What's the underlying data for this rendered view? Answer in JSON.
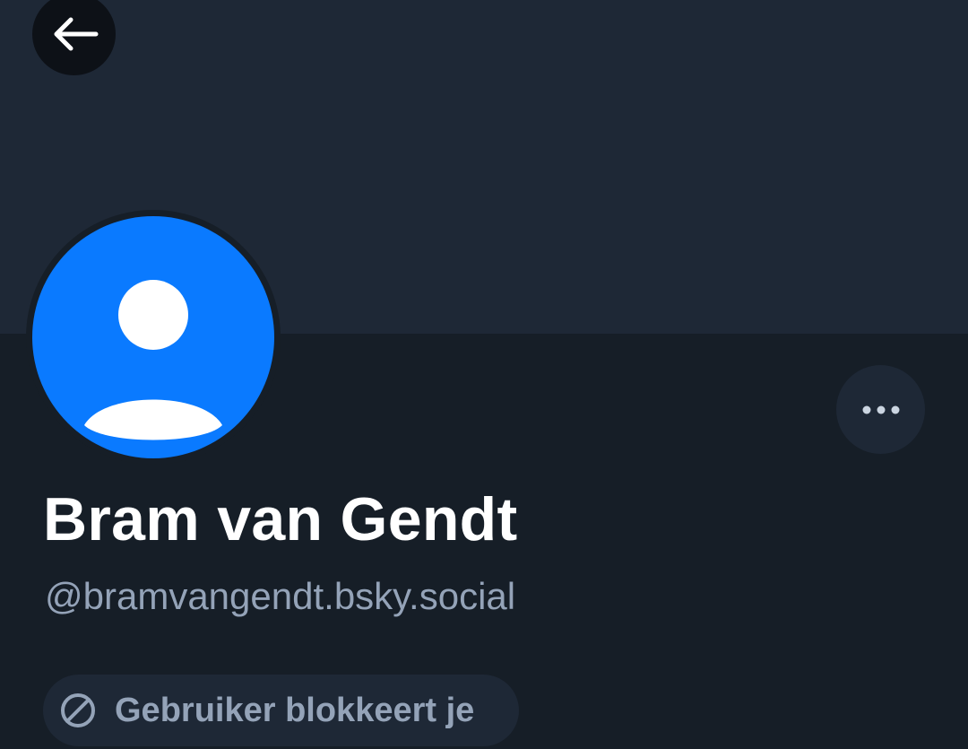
{
  "profile": {
    "display_name": "Bram van Gendt",
    "handle": "@bramvangendt.bsky.social",
    "status_badge": "Gebruiker blokkeert je"
  },
  "icons": {
    "back": "arrow-left-icon",
    "avatar": "default-user-avatar-icon",
    "more": "ellipsis-icon",
    "blocked": "block-circle-icon"
  },
  "colors": {
    "background": "#161e27",
    "banner": "#1e2836",
    "avatar_accent": "#0a7aff",
    "text_primary": "#ffffff",
    "text_secondary": "#94a3b8"
  }
}
